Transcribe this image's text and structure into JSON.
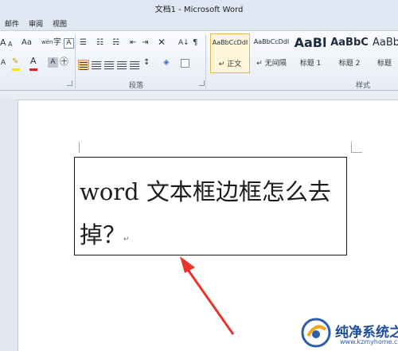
{
  "window": {
    "title": "文档1 - Microsoft Word"
  },
  "tabs": [
    "邮件",
    "审阅",
    "视图"
  ],
  "ribbon": {
    "font_group": {
      "grow_font": "A",
      "shrink_font": "A",
      "case_button": "Aa",
      "phonetic": "wén",
      "char_border": "A",
      "font_color": "A",
      "char_shade": "A",
      "enclose": "字"
    },
    "paragraph_group": {
      "label": "段落",
      "sort": "A↓",
      "show_marks": "¶"
    },
    "styles_group": {
      "label": "样式",
      "styles": [
        {
          "preview": "AaBbCcDdI",
          "name": "↵ 正文",
          "selected": true
        },
        {
          "preview": "AaBbCcDdI",
          "name": "↵ 无间隔",
          "selected": false
        },
        {
          "preview": "AaBl",
          "name": "标题 1",
          "selected": false
        },
        {
          "preview": "AaBbC",
          "name": "标题 2",
          "selected": false
        },
        {
          "preview": "AaBb",
          "name": "标题",
          "selected": false
        }
      ]
    }
  },
  "document": {
    "textbox_text": "word 文本框边框怎么去掉？",
    "paragraph_mark": "↵"
  },
  "annotation": {
    "arrow_color": "#e8342a"
  },
  "watermark": {
    "name": "纯净系统之家",
    "url": "www.kzmyhome.com"
  }
}
